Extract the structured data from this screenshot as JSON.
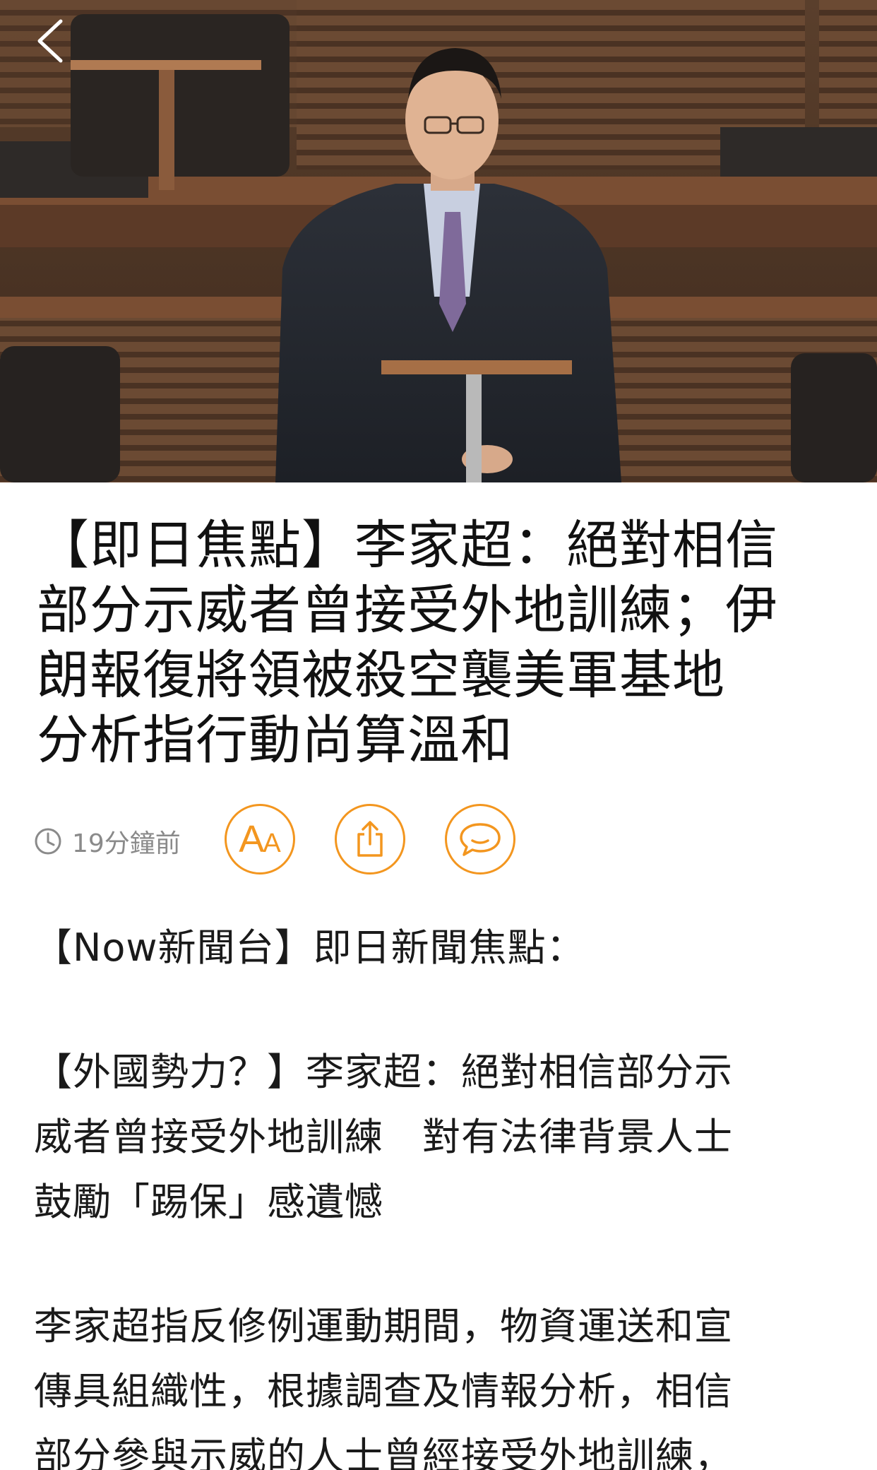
{
  "headline": {
    "lines": [
      "【即日焦點】李家超：絕對相信",
      "部分示威者曾接受外地訓練；伊",
      "朗報復將領被殺空襲美軍基地",
      "分析指行動尚算溫和"
    ]
  },
  "meta": {
    "time_ago": "19分鐘前",
    "font_button": {
      "big": "A",
      "small": "A"
    }
  },
  "body": {
    "intro": "【Now新聞台】即日新聞焦點：",
    "section1_lines": [
      "【外國勢力？】李家超：絕對相信部分示",
      "威者曾接受外地訓練　對有法律背景人士",
      "鼓勵「踢保」感遺憾"
    ],
    "section2_lines": [
      "李家超指反修例運動期間，物資運送和宣",
      "傳具組織性，根據調查及情報分析，相信",
      "部分參與示威的人士曾經接受外地訓練，"
    ]
  },
  "colors": {
    "accent": "#f3961f",
    "meta_text": "#8a8a8a",
    "headline": "#111111"
  },
  "icons": {
    "back": "chevron-left-icon",
    "clock": "clock-icon",
    "font_size": "font-size-icon",
    "share": "share-icon",
    "comment": "comment-icon"
  }
}
